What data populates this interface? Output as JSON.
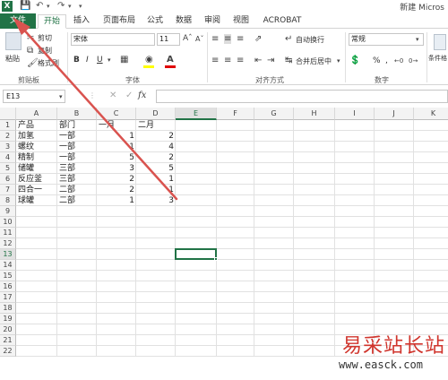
{
  "titlebar": {
    "title": "新建 Micros"
  },
  "tabs": [
    {
      "label": "文件"
    },
    {
      "label": "开始"
    },
    {
      "label": "插入"
    },
    {
      "label": "页面布局"
    },
    {
      "label": "公式"
    },
    {
      "label": "数据"
    },
    {
      "label": "审阅"
    },
    {
      "label": "视图"
    },
    {
      "label": "ACROBAT"
    }
  ],
  "ribbon": {
    "clipboard": {
      "paste": "粘贴",
      "cut": "剪切",
      "copy": "复制",
      "format_painter": "格式刷",
      "group": "剪贴板"
    },
    "font": {
      "name": "宋体",
      "size": "11",
      "bold": "B",
      "italic": "I",
      "underline": "U",
      "group": "字体"
    },
    "alignment": {
      "wrap": "自动换行",
      "merge": "合并后居中",
      "group": "对齐方式"
    },
    "number": {
      "format": "常规",
      "percent": "%",
      "comma": ",",
      "group": "数字"
    },
    "styles": {
      "conditional": "条件格"
    }
  },
  "formula_bar": {
    "name_box": "E13",
    "fx": "fx",
    "value": ""
  },
  "sheet": {
    "columns": [
      "A",
      "B",
      "C",
      "D",
      "E",
      "F",
      "G",
      "H",
      "I",
      "J",
      "K"
    ],
    "rows": [
      "1",
      "2",
      "3",
      "4",
      "5",
      "6",
      "7",
      "8",
      "9",
      "10",
      "11",
      "12",
      "13",
      "14",
      "15",
      "16",
      "17",
      "18",
      "19",
      "20",
      "21",
      "22"
    ],
    "data": [
      [
        "产品",
        "部门",
        "一月",
        "二月"
      ],
      [
        "加氢",
        "一部",
        "1",
        "2"
      ],
      [
        "螺纹",
        "一部",
        "1",
        "4"
      ],
      [
        "精制",
        "一部",
        "5",
        "2"
      ],
      [
        "储罐",
        "三部",
        "3",
        "5"
      ],
      [
        "反应釜",
        "三部",
        "2",
        "1"
      ],
      [
        "四合一",
        "二部",
        "2",
        "1"
      ],
      [
        "球罐",
        "二部",
        "1",
        "3"
      ]
    ],
    "selected_cell": "E13"
  },
  "watermark": {
    "title": "易采站长站",
    "url": "www.easck.com"
  },
  "colors": {
    "accent": "#217346",
    "arrow": "#d9534f"
  }
}
